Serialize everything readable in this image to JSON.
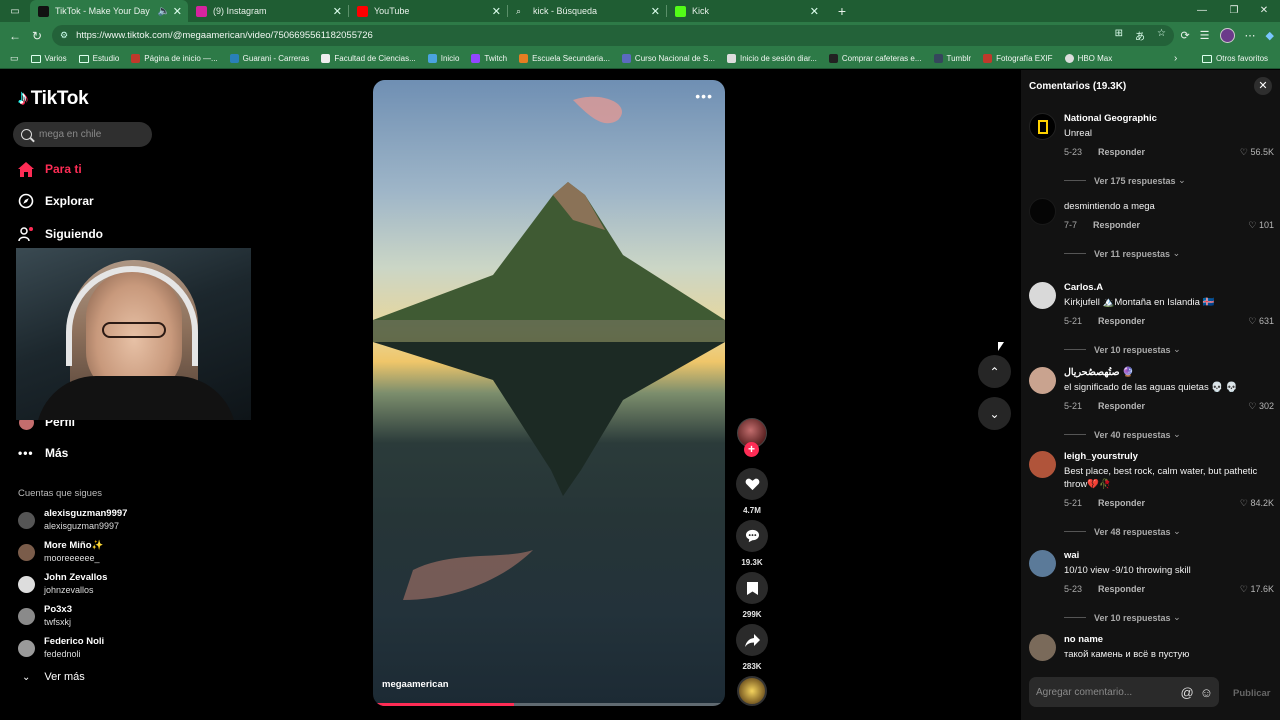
{
  "browser": {
    "tabs": [
      {
        "title": "TikTok - Make Your Day",
        "color": "#111111",
        "active": true
      },
      {
        "title": "(9) Instagram",
        "color": "#d6249f",
        "active": false
      },
      {
        "title": "YouTube",
        "color": "#ff0000",
        "active": false
      },
      {
        "title": "kick - Búsqueda",
        "color": "#2d7a47",
        "active": false
      },
      {
        "title": "Kick",
        "color": "#53fc18",
        "active": false
      }
    ],
    "url": "https://www.tiktok.com/@megaamerican/video/7506695561182055726",
    "bookmarks": [
      {
        "label": "Varios",
        "folder": true
      },
      {
        "label": "Estudio",
        "folder": true
      },
      {
        "label": "Página de inicio —...",
        "color": "#c0392b"
      },
      {
        "label": "Guarani - Carreras",
        "color": "#2980b9"
      },
      {
        "label": "Facultad de Ciencias...",
        "color": "#eeeeee"
      },
      {
        "label": "Inicio",
        "color": "#4aa3df"
      },
      {
        "label": "Twitch",
        "color": "#9146ff"
      },
      {
        "label": "Escuela Secundaria...",
        "color": "#e67e22"
      },
      {
        "label": "Curso Nacional de S...",
        "color": "#5b6abf"
      },
      {
        "label": "Inicio de sesión diar...",
        "color": "#dddddd"
      },
      {
        "label": "Comprar cafeteras e...",
        "color": "#222222"
      },
      {
        "label": "Tumblr",
        "color": "#35465c"
      },
      {
        "label": "Fotografía EXIF",
        "color": "#c0392b"
      },
      {
        "label": "HBO Max",
        "color": "#dddddd"
      }
    ],
    "other_bookmarks": "Otros favoritos"
  },
  "sidebar": {
    "logo": "TikTok",
    "search_placeholder": "mega en chile",
    "nav": {
      "for_you": "Para ti",
      "explore": "Explorar",
      "following": "Siguiendo",
      "profile": "Perfil",
      "more": "Más"
    },
    "following_title": "Cuentas que sigues",
    "accounts": [
      {
        "name": "alexisguzman9997",
        "handle": "alexisguzman9997",
        "color": "#555555"
      },
      {
        "name": "More Miño✨",
        "handle": "mooreeeeee_",
        "color": "#7a5c4a"
      },
      {
        "name": "John Zevallos",
        "handle": "johnzevallos",
        "color": "#dddddd"
      },
      {
        "name": "Po3x3",
        "handle": "twfsxkj",
        "color": "#8a8a8a"
      },
      {
        "name": "Federico Noli",
        "handle": "fedednoli",
        "color": "#9a9a9a"
      }
    ],
    "see_more": "Ver más"
  },
  "video": {
    "author": "megaamerican",
    "progress": 0.4,
    "likes": "4.7M",
    "comments": "19.3K",
    "saves": "299K",
    "shares": "283K"
  },
  "comments_panel": {
    "title": "Comentarios (19.3K)",
    "reply_label": "Responder",
    "items": [
      {
        "user": "National Geographic",
        "text": "Unreal",
        "date": "5-23",
        "likes": "56.5K",
        "replies": "Ver 175 respuestas",
        "avatar": "#000000"
      },
      {
        "user": "",
        "text": "desmintiendo a mega",
        "date": "7-7",
        "likes": "101",
        "replies": "Ver 11 respuestas",
        "avatar": "#050505"
      },
      {
        "user": "Carlos.A",
        "text": "Kirkjufell 🏔️Montaña en Islandia 🇮🇸",
        "date": "5-21",
        "likes": "631",
        "replies": "Ver 10 respuestas",
        "avatar": "#d9d9d9"
      },
      {
        "user": "صتُهصصُحريال 🔮",
        "text": "el significado de las aguas quietas 💀 💀",
        "date": "5-21",
        "likes": "302",
        "replies": "Ver 40 respuestas",
        "avatar": "#c9a38f"
      },
      {
        "user": "leigh_yourstruly",
        "text": "Best place, best rock, calm water, but pathetic throw💔🥀",
        "date": "5-21",
        "likes": "84.2K",
        "replies": "Ver 48 respuestas",
        "avatar": "#b0543a"
      },
      {
        "user": "wai",
        "text": "10/10 view -9/10 throwing skill",
        "date": "5-23",
        "likes": "17.6K",
        "replies": "Ver 10 respuestas",
        "avatar": "#5b7a99"
      },
      {
        "user": "no name",
        "text": "такой камень и всё в пустую",
        "date": "",
        "likes": "",
        "replies": "",
        "avatar": "#7a6a5a"
      }
    ],
    "add_placeholder": "Agregar comentario...",
    "publish": "Publicar"
  }
}
